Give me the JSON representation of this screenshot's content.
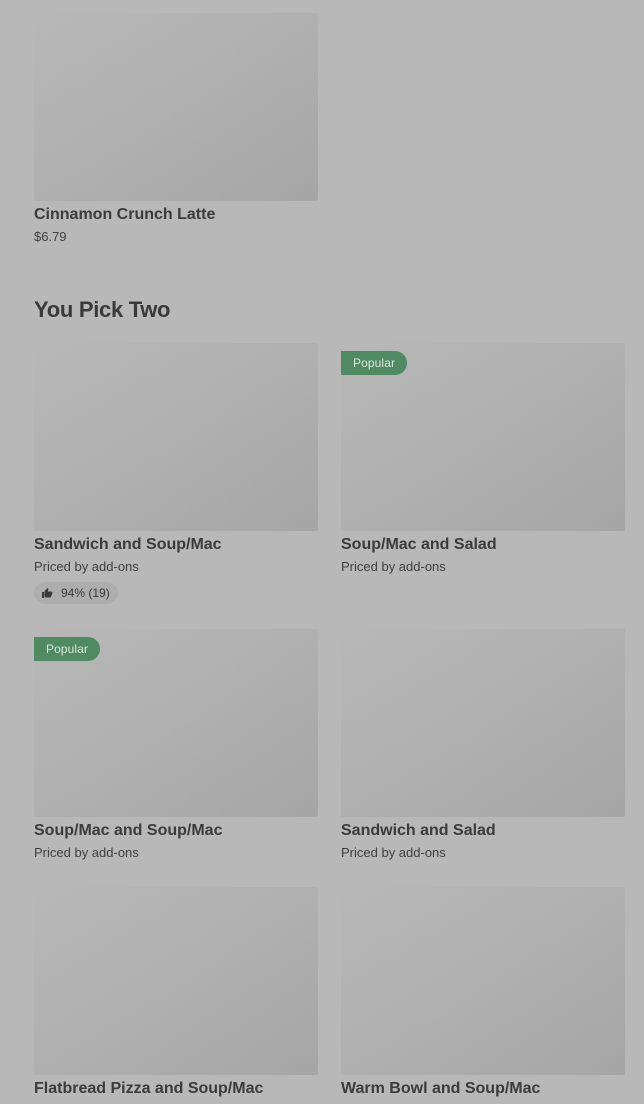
{
  "top_item": {
    "name": "Cinnamon Crunch Latte",
    "price": "$6.79"
  },
  "section": {
    "title": "You Pick Two",
    "items": [
      {
        "name": "Sandwich and Soup/Mac",
        "price": "Priced by add-ons",
        "badge": "",
        "rating": "94% (19)"
      },
      {
        "name": "Soup/Mac and Salad",
        "price": "Priced by add-ons",
        "badge": "Popular"
      },
      {
        "name": "Soup/Mac and Soup/Mac",
        "price": "Priced by add-ons",
        "badge": "Popular"
      },
      {
        "name": "Sandwich and Salad",
        "price": "Priced by add-ons",
        "badge": ""
      },
      {
        "name": "Flatbread Pizza and Soup/Mac",
        "badge": ""
      },
      {
        "name": "Warm Bowl and Soup/Mac",
        "badge": ""
      }
    ]
  },
  "colors": {
    "overlay_background": "#b8b8b8",
    "badge_background": "#4f8a63",
    "badge_text": "#d9e7dd",
    "text_primary": "#3a3a3a"
  },
  "icons": {
    "rating": "thumbs-up-icon"
  }
}
